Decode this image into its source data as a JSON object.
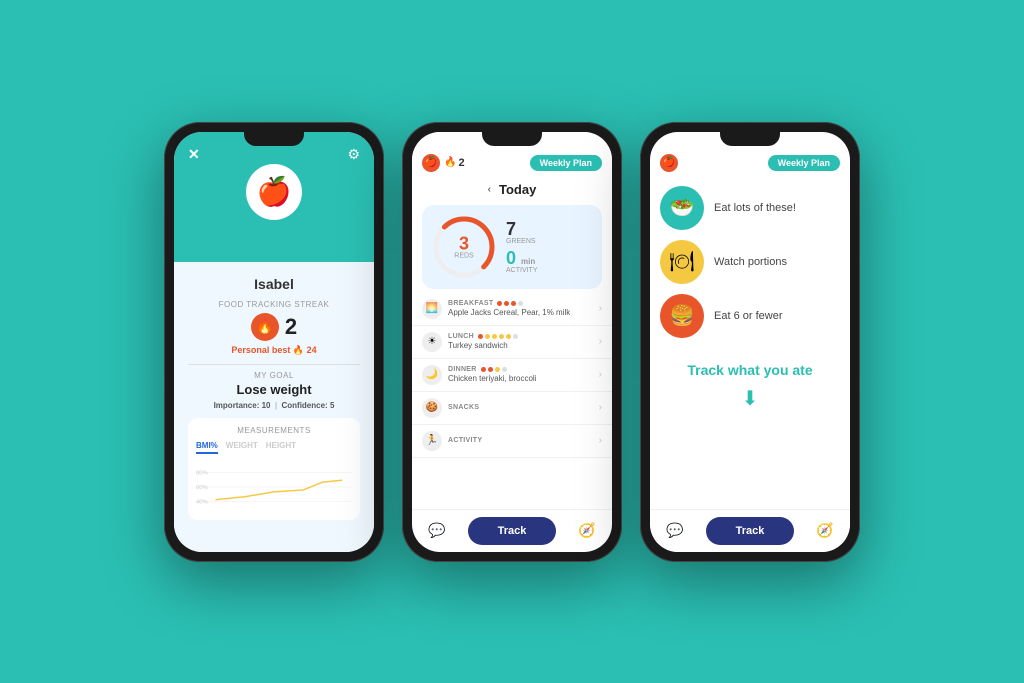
{
  "app": {
    "background_color": "#2bbfb3"
  },
  "phone1": {
    "close_label": "✕",
    "gear_label": "⚙",
    "apple_emoji": "🍎",
    "user_name": "Isabel",
    "streak_section_label": "FOOD TRACKING STREAK",
    "streak_number": "2",
    "personal_best_label": "Personal best",
    "personal_best_icon": "🔥",
    "personal_best_value": "24",
    "goal_section_label": "MY GOAL",
    "goal_title": "Lose weight",
    "importance_label": "Importance:",
    "importance_value": "10",
    "confidence_label": "Confidence:",
    "confidence_value": "5",
    "measurements_label": "MEASUREMENTS",
    "tab_bmi": "BMI%",
    "tab_weight": "WEIGHT",
    "tab_height": "HEIGHT",
    "chart_label_80": "80%",
    "chart_label_60": "60%",
    "chart_label_40": "40%"
  },
  "phone2": {
    "apple_emoji": "🍎",
    "streak_icon": "🔥",
    "streak_count": "2",
    "weekly_plan_label": "Weekly Plan",
    "nav_arrow_left": "‹",
    "today_label": "Today",
    "reds_number": "3",
    "reds_label": "REDS",
    "greens_number": "7",
    "greens_label": "GREENS",
    "activity_number": "0",
    "activity_unit": "min",
    "activity_label": "ACTIVITY",
    "meals": [
      {
        "name": "BREAKFAST",
        "description": "Apple Jacks Cereal, Pear, 1% milk",
        "dots": [
          "red",
          "red",
          "red",
          "gray"
        ],
        "icon": "🌅"
      },
      {
        "name": "LUNCH",
        "description": "Turkey sandwich",
        "dots": [
          "red",
          "yellow",
          "yellow",
          "yellow",
          "yellow",
          "gray"
        ],
        "icon": "☀"
      },
      {
        "name": "DINNER",
        "description": "Chicken teriyaki, broccoli",
        "dots": [
          "red",
          "red",
          "yellow",
          "gray"
        ],
        "icon": "🌙"
      },
      {
        "name": "SNACKS",
        "description": "",
        "dots": [],
        "icon": "🍪"
      },
      {
        "name": "ACTIVITY",
        "description": "",
        "dots": [],
        "icon": "🏃"
      }
    ],
    "track_label": "Track",
    "chat_icon": "💬",
    "compass_icon": "🧭"
  },
  "phone3": {
    "apple_emoji": "🍎",
    "weekly_plan_label": "Weekly Plan",
    "guide_items": [
      {
        "icon": "🥗",
        "color_class": "guide-icon-teal",
        "text": "Eat lots of these!"
      },
      {
        "icon": "🍽",
        "color_class": "guide-icon-yellow",
        "text": "Watch portions"
      },
      {
        "icon": "🍔",
        "color_class": "guide-icon-red",
        "text": "Eat 6 or fewer"
      }
    ],
    "track_cta_title": "Track what you ate",
    "down_arrow": "⬇",
    "track_label": "Track",
    "chat_icon": "💬",
    "compass_icon": "🧭"
  }
}
